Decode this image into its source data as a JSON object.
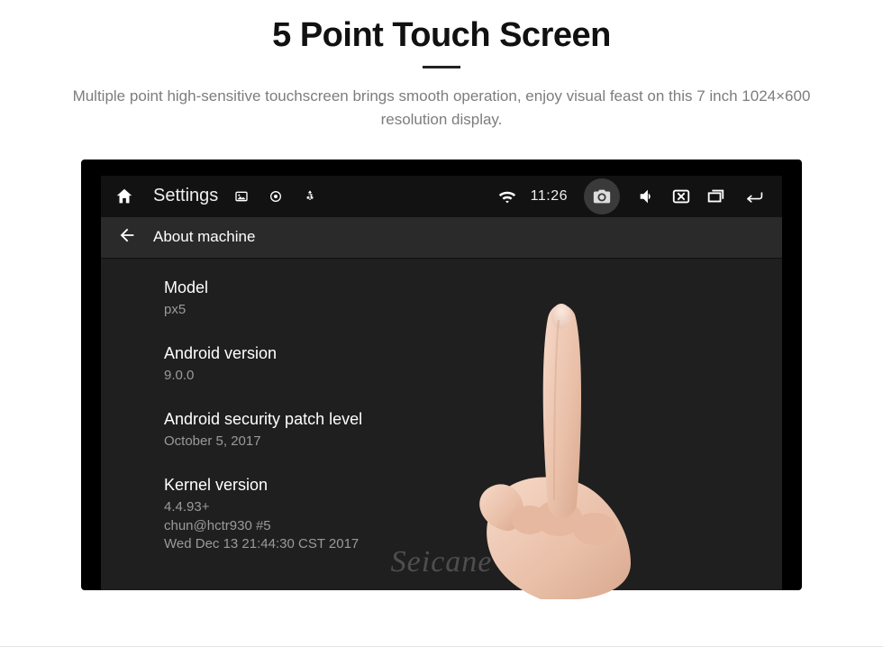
{
  "hero": {
    "title": "5 Point Touch Screen",
    "subtitle": "Multiple point high-sensitive touchscreen brings smooth operation, enjoy visual feast on this 7 inch 1024×600 resolution display."
  },
  "statusbar": {
    "title": "Settings",
    "time": "11:26"
  },
  "subheader": {
    "title": "About machine"
  },
  "about": {
    "items": [
      {
        "primary": "Model",
        "secondary": "px5"
      },
      {
        "primary": "Android version",
        "secondary": "9.0.0"
      },
      {
        "primary": "Android security patch level",
        "secondary": "October 5, 2017"
      },
      {
        "primary": "Kernel version",
        "secondary": "4.4.93+\nchun@hctr930 #5\nWed Dec 13 21:44:30 CST 2017"
      }
    ]
  },
  "watermark": "Seicane"
}
